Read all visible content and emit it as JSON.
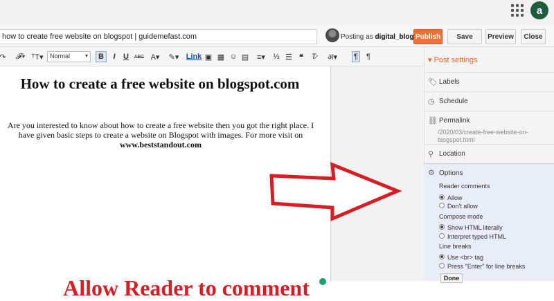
{
  "header": {
    "account_initial": "a"
  },
  "post": {
    "title_value": "how to create free website on blogspot | guidemefast.com",
    "heading": "How to create a free website on blogspot.com",
    "body": "Are you interested to know about how to create a free website then you got the right place. I have given basic steps to create a website on Blogspot with images. For more visit on",
    "link": "www.beststandout.com"
  },
  "author": {
    "posting_prefix": "Posting as",
    "name": "digital_blogger"
  },
  "actions": {
    "publish": "Publish",
    "save": "Save",
    "preview": "Preview",
    "close": "Close"
  },
  "toolbar": {
    "format_value": "Normal",
    "bold": "B",
    "italic": "I",
    "underline": "U",
    "strike": "ABC",
    "link": "Link",
    "hindi": "अ"
  },
  "sidebar": {
    "heading": "Post settings",
    "labels": "Labels",
    "schedule": "Schedule",
    "permalink": "Permalink",
    "permalink_url": "/2020/03/create-free-website-on-blogspot.html",
    "location": "Location",
    "options": "Options",
    "reader_comments": "Reader comments",
    "allow": "Allow",
    "dont_allow": "Don't allow",
    "compose_mode": "Compose mode",
    "show_html": "Show HTML literally",
    "interpret_html": "Interpret typed HTML",
    "line_breaks": "Line breaks",
    "use_br": "Use <br> tag",
    "press_enter": "Press \"Enter\" for line breaks",
    "done": "Done"
  },
  "annotation": {
    "text": "Allow Reader to comment"
  },
  "colors": {
    "accent": "#e2642b",
    "publish": "#f0703a",
    "callout": "#d51e25",
    "account": "#1e5b3f"
  }
}
